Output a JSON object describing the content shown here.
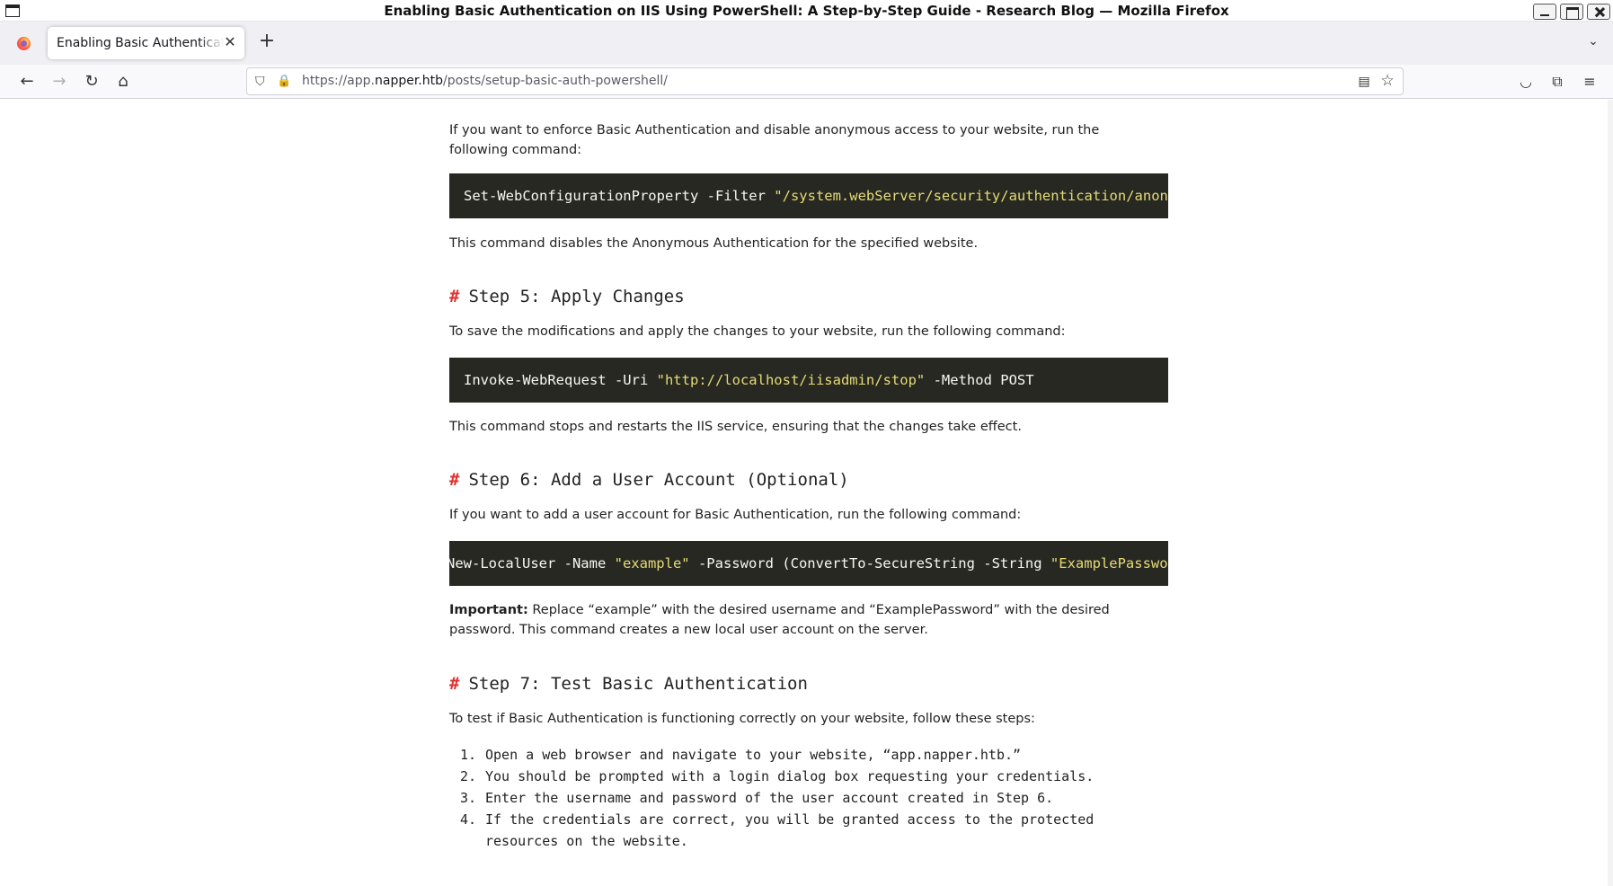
{
  "window": {
    "title": "Enabling Basic Authentication on IIS Using PowerShell: A Step-by-Step Guide - Research Blog — Mozilla Firefox"
  },
  "tabs": [
    {
      "label": "Enabling Basic Authentication on IIS Using PowerShell: A Step-by-Step Guide - Research Blog"
    }
  ],
  "urlbar": {
    "prefix": "https://app.",
    "host": "napper.htb",
    "path": "/posts/setup-basic-auth-powershell/"
  },
  "glyphs": {
    "close": "✕",
    "plus": "+",
    "chevron": "⌄",
    "back": "←",
    "forward": "→",
    "reload": "↻",
    "home": "⌂",
    "shield": "⛉",
    "lock": "🔒",
    "reader": "▤",
    "star": "☆",
    "pocket": "◡",
    "extensions": "⧉",
    "menu": "≡",
    "hash": "#"
  },
  "article": {
    "intro": "If you want to enforce Basic Authentication and disable anonymous access to your website, run the following command:",
    "code1": {
      "cmd": "Set-WebConfigurationProperty -Filter ",
      "str": "\"/system.webServer/security/authentication/anonymousAuthentication\""
    },
    "code1_note": "This command disables the Anonymous Authentication for the specified website.",
    "step5": {
      "title": "Step 5: Apply Changes",
      "intro": "To save the modifications and apply the changes to your website, run the following command:",
      "code": {
        "cmd": "Invoke-WebRequest -Uri ",
        "str": "\"http://localhost/iisadmin/stop\"",
        "rest": " -Method POST"
      },
      "note": "This command stops and restarts the IIS service, ensuring that the changes take effect."
    },
    "step6": {
      "title": "Step 6: Add a User Account (Optional)",
      "intro": "If you want to add a user account for Basic Authentication, run the following command:",
      "code": {
        "prefix": "New-LocalUser -Name ",
        "str1": "\"example\"",
        "mid": " -Password (ConvertTo-SecureString -String ",
        "str2": "\"ExamplePassword\""
      },
      "important_label": "Important:",
      "important_text": " Replace “example” with the desired username and “ExamplePassword” with the desired password. This command creates a new local user account on the server."
    },
    "step7": {
      "title": "Step 7: Test Basic Authentication",
      "intro": "To test if Basic Authentication is functioning correctly on your website, follow these steps:",
      "items": [
        {
          "num": "1.",
          "text": "Open a web browser and navigate to your website, “app.napper.htb.”"
        },
        {
          "num": "2.",
          "text": "You should be prompted with a login dialog box requesting your credentials."
        },
        {
          "num": "3.",
          "text": "Enter the username and password of the user account created in Step 6."
        },
        {
          "num": "4.",
          "text": "If the credentials are correct, you will be granted access to the protected resources on the website."
        }
      ]
    }
  }
}
